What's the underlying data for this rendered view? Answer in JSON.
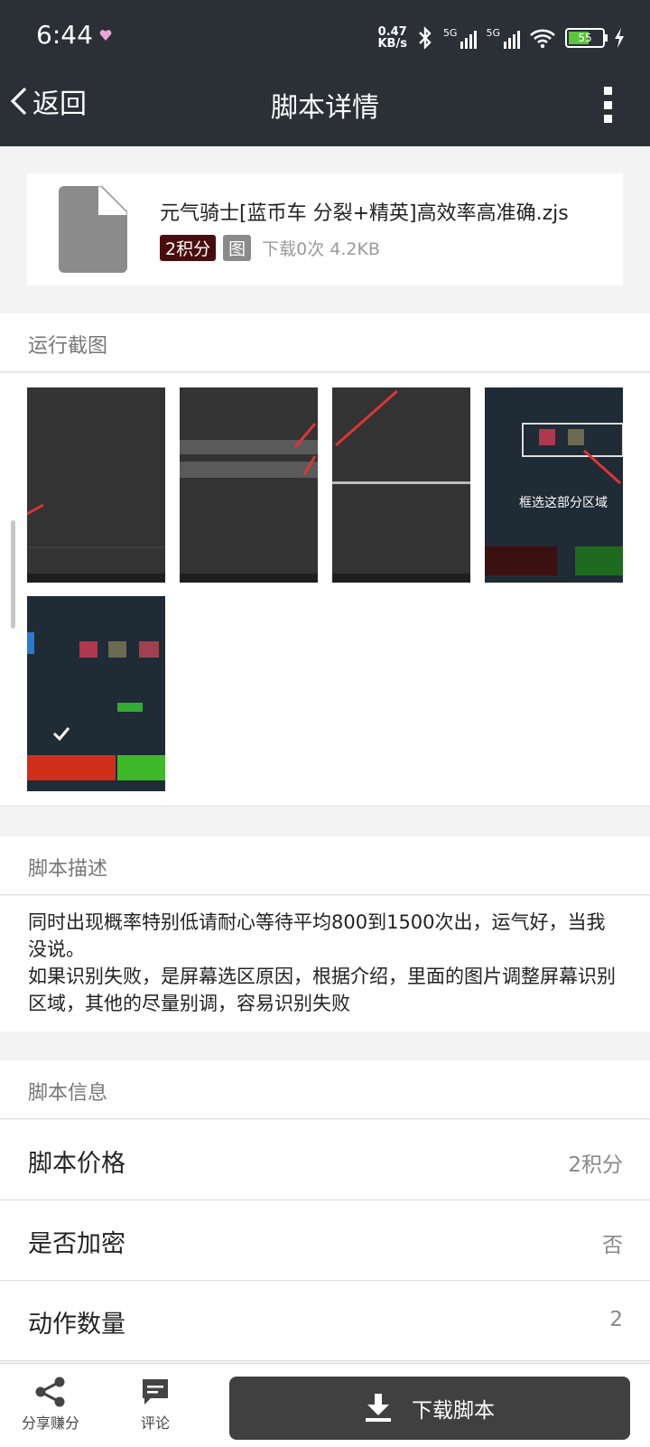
{
  "status_bar": {
    "time": "6:44",
    "net_speed_value": "0.47",
    "net_speed_unit": "KB/s",
    "sim1": "5G",
    "sim2": "5G",
    "battery": "55"
  },
  "header": {
    "back_label": "返回",
    "title": "脚本详情"
  },
  "file": {
    "name": "元气骑士[蓝币车 分裂+精英]高效率高准确.zjs",
    "points_badge": "2积分",
    "image_badge": "图",
    "meta": "下载0次 4.2KB"
  },
  "screenshots": {
    "title": "运行截图",
    "shot4_caption": "框选这部分区域"
  },
  "description": {
    "title": "脚本描述",
    "text": "同时出现概率特别低请耐心等待平均800到1500次出，运气好，当我没说。\n如果识别失败，是屏幕选区原因，根据介绍，里面的图片调整屏幕识别区域，其他的尽量别调，容易识别失败"
  },
  "info": {
    "title": "脚本信息",
    "rows": [
      {
        "key": "脚本价格",
        "value": "2积分"
      },
      {
        "key": "是否加密",
        "value": "否"
      },
      {
        "key": "动作数量",
        "value": "2"
      }
    ]
  },
  "bottom_bar": {
    "share_label": "分享赚分",
    "comment_label": "评论",
    "download_label": "下载脚本"
  },
  "colors": {
    "header_bg": "#2b2f36",
    "points_badge": "#4a0d0d",
    "download_button": "#404040"
  }
}
